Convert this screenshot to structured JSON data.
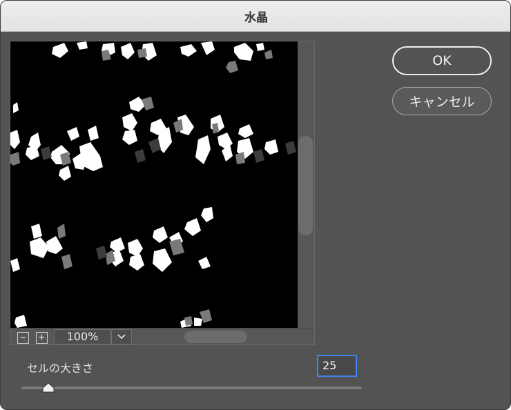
{
  "dialog": {
    "title": "水晶",
    "ok_label": "OK",
    "cancel_label": "キャンセル"
  },
  "preview": {
    "zoom_out_symbol": "−",
    "zoom_in_symbol": "+",
    "zoom_level": "100%"
  },
  "cell_size": {
    "label": "セルの大きさ",
    "value": "25",
    "slider_fraction": 0.08
  },
  "colors": {
    "panel_bg": "#535353",
    "titlebar_bg": "#e8e8e8",
    "focus_ring": "#3f86f0",
    "preview_bg": "#000000"
  }
}
